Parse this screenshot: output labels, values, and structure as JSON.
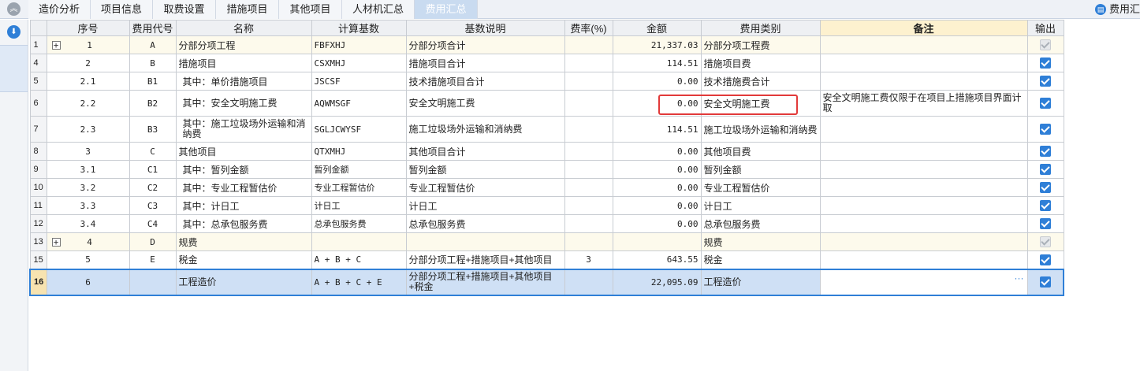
{
  "tabs": [
    {
      "label": "造价分析",
      "active": false
    },
    {
      "label": "项目信息",
      "active": false
    },
    {
      "label": "取费设置",
      "active": false
    },
    {
      "label": "措施项目",
      "active": false
    },
    {
      "label": "其他项目",
      "active": false
    },
    {
      "label": "人材机汇总",
      "active": false
    },
    {
      "label": "费用汇总",
      "active": true
    }
  ],
  "fee_summary_link": "费用汇",
  "columns": [
    "序号",
    "费用代号",
    "名称",
    "计算基数",
    "基数说明",
    "费率(%)",
    "金额",
    "费用类别",
    "备注",
    "输出"
  ],
  "rows": [
    {
      "rownum": "1",
      "expand": "+",
      "seq": "1",
      "code": "A",
      "name": "分部分项工程",
      "base": "FBFXHJ",
      "base_desc": "分部分项合计",
      "rate": "",
      "amount": "21,337.03",
      "category": "分部分项工程费",
      "remark": "",
      "output": "disabled",
      "type": "group"
    },
    {
      "rownum": "4",
      "expand": "",
      "seq": "2",
      "code": "B",
      "name": "措施项目",
      "base": "CSXMHJ",
      "base_desc": "措施项目合计",
      "rate": "",
      "amount": "114.51",
      "category": "措施项目费",
      "remark": "",
      "output": "checked",
      "type": "normal"
    },
    {
      "rownum": "5",
      "expand": "",
      "seq": "2.1",
      "code": "B1",
      "name": "其中：单价措施项目",
      "base": "JSCSF",
      "base_desc": "技术措施项目合计",
      "rate": "",
      "amount": "0.00",
      "category": "技术措施费合计",
      "remark": "",
      "output": "checked",
      "type": "normal"
    },
    {
      "rownum": "6",
      "expand": "",
      "seq": "2.2",
      "code": "B2",
      "name": "其中：安全文明施工费",
      "base": "AQWMSGF",
      "base_desc": "安全文明施工费",
      "rate": "",
      "amount": "0.00",
      "category": "安全文明施工费",
      "remark": "安全文明施工费仅限于在项目上措施项目界面计取",
      "output": "checked",
      "type": "tall"
    },
    {
      "rownum": "7",
      "expand": "",
      "seq": "2.3",
      "code": "B3",
      "name": "其中：施工垃圾场外运输和消纳费",
      "base": "SGLJCWYSF",
      "base_desc": "施工垃圾场外运输和消纳费",
      "rate": "",
      "amount": "114.51",
      "category": "施工垃圾场外运输和消纳费",
      "remark": "",
      "output": "checked",
      "type": "tall"
    },
    {
      "rownum": "8",
      "expand": "",
      "seq": "3",
      "code": "C",
      "name": "其他项目",
      "base": "QTXMHJ",
      "base_desc": "其他项目合计",
      "rate": "",
      "amount": "0.00",
      "category": "其他项目费",
      "remark": "",
      "output": "checked",
      "type": "normal"
    },
    {
      "rownum": "9",
      "expand": "",
      "seq": "3.1",
      "code": "C1",
      "name": "其中：暂列金额",
      "base": "暂列金额",
      "base_desc": "暂列金额",
      "rate": "",
      "amount": "0.00",
      "category": "暂列金额",
      "remark": "",
      "output": "checked",
      "type": "normal"
    },
    {
      "rownum": "10",
      "expand": "",
      "seq": "3.2",
      "code": "C2",
      "name": "其中：专业工程暂估价",
      "base": "专业工程暂估价",
      "base_desc": "专业工程暂估价",
      "rate": "",
      "amount": "0.00",
      "category": "专业工程暂估价",
      "remark": "",
      "output": "checked",
      "type": "normal"
    },
    {
      "rownum": "11",
      "expand": "",
      "seq": "3.3",
      "code": "C3",
      "name": "其中：计日工",
      "base": "计日工",
      "base_desc": "计日工",
      "rate": "",
      "amount": "0.00",
      "category": "计日工",
      "remark": "",
      "output": "checked",
      "type": "normal"
    },
    {
      "rownum": "12",
      "expand": "",
      "seq": "3.4",
      "code": "C4",
      "name": "其中：总承包服务费",
      "base": "总承包服务费",
      "base_desc": "总承包服务费",
      "rate": "",
      "amount": "0.00",
      "category": "总承包服务费",
      "remark": "",
      "output": "checked",
      "type": "normal"
    },
    {
      "rownum": "13",
      "expand": "+",
      "seq": "4",
      "code": "D",
      "name": "规费",
      "base": "",
      "base_desc": "",
      "rate": "",
      "amount": "",
      "category": "规费",
      "remark": "",
      "output": "disabled",
      "type": "group"
    },
    {
      "rownum": "15",
      "expand": "",
      "seq": "5",
      "code": "E",
      "name": "税金",
      "base": "A + B + C",
      "base_desc": "分部分项工程+措施项目+其他项目",
      "rate": "3",
      "amount": "643.55",
      "category": "税金",
      "remark": "",
      "output": "checked",
      "type": "normal"
    },
    {
      "rownum": "16",
      "expand": "",
      "seq": "6",
      "code": "",
      "name": "工程造价",
      "base": "A + B + C + E",
      "base_desc": "分部分项工程+措施项目+其他项目+税金",
      "rate": "",
      "amount": "22,095.09",
      "category": "工程造价",
      "remark": "",
      "output": "checked",
      "type": "selected"
    }
  ],
  "colors": {
    "accent": "#2f7fd7",
    "highlight": "#e23a3a",
    "remark_header": "#fdf1cf",
    "selected_row": "#cfe0f5"
  }
}
